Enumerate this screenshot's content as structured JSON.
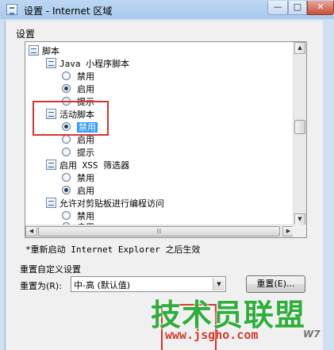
{
  "window": {
    "title": "设置 - Internet 区域",
    "min_glyph": "—",
    "max_glyph": "□",
    "close_glyph": "✕"
  },
  "group_label": "设置",
  "tree": {
    "script": "脚本",
    "java_applet": "Java 小程序脚本",
    "java_disable": "禁用",
    "java_enable": "启用",
    "java_prompt": "提示",
    "active_script": "活动脚本",
    "active_disable": "禁用",
    "active_enable": "启用",
    "active_prompt": "提示",
    "xss_filter": "启用 XSS 筛选器",
    "xss_disable": "禁用",
    "xss_enable": "启用",
    "clipboard": "允许对剪贴板进行编程访问",
    "clip_disable": "禁用",
    "clip_partial": "启用"
  },
  "note": "*重新启动 Internet Explorer 之后生效",
  "reset_group": {
    "title": "重置自定义设置",
    "label": "重置为(R):",
    "selected": "中-高 (默认值)",
    "button": "重置(E)..."
  },
  "watermark": {
    "text": "技术员联盟",
    "url": "www.jsgho.com",
    "corner": "W7"
  },
  "colors": {
    "highlight": "#d93232",
    "selection": "#3399ff",
    "watermark_green": "#2fae3c",
    "watermark_red": "#d43a2c"
  }
}
